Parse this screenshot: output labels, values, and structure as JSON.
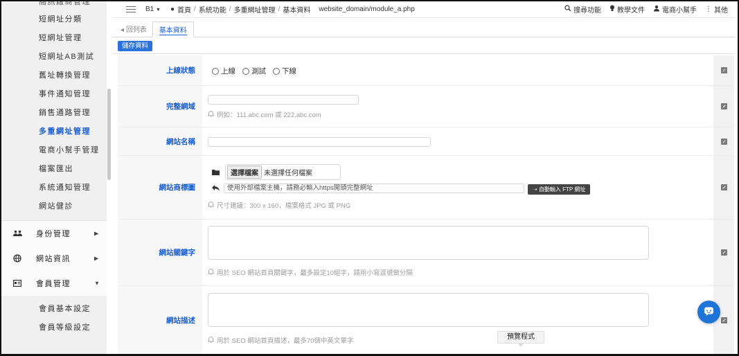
{
  "sidebar": {
    "top_sub_items": [
      {
        "label": "簡訊廠商管理"
      },
      {
        "label": "短網址分類"
      },
      {
        "label": "短網址管理"
      },
      {
        "label": "短網址AB測試"
      },
      {
        "label": "舊址轉換管理"
      },
      {
        "label": "事件通知管理"
      },
      {
        "label": "銷售通路管理"
      },
      {
        "label": "多重網址管理",
        "active": true
      },
      {
        "label": "電商小幫手管理"
      },
      {
        "label": "檔案匯出"
      },
      {
        "label": "系統通知管理"
      },
      {
        "label": "網站健診"
      }
    ],
    "main_items": [
      {
        "label": "身份管理",
        "icon": "users-icon"
      },
      {
        "label": "網站資訊",
        "icon": "globe-icon"
      },
      {
        "label": "會員管理",
        "icon": "id-card-icon"
      }
    ],
    "member_sub_items": [
      {
        "label": "會員基本設定"
      },
      {
        "label": "會員等級設定"
      }
    ]
  },
  "topbar": {
    "branch": "B1",
    "breadcrumbs": [
      "首頁",
      "系統功能",
      "多重網址管理",
      "基本資料"
    ],
    "path": "website_domain/module_a.php",
    "search": "搜尋功能",
    "docs": "教學文件",
    "helper": "電商小幫手",
    "more": "其他"
  },
  "tabs": {
    "back": "回列表",
    "basic": "基本資料"
  },
  "save_button": "儲存資料",
  "form": {
    "status": {
      "label": "上線狀態",
      "options": [
        "上線",
        "測試",
        "下線"
      ]
    },
    "domain": {
      "label": "完整網域",
      "value": "",
      "hint": "例如：111.abc.com 或 222.abc.com"
    },
    "site_name": {
      "label": "網站名稱",
      "value": ""
    },
    "logo": {
      "label": "網站商標圖",
      "file_button": "選擇檔案",
      "file_status": "未選擇任何檔案",
      "url_placeholder": "使用外部檔案主機，請務必輸入https開頭完整網址",
      "ftp_button": "自動輸入 FTP 網址",
      "hint": "尺寸建議：300 x 160，檔案格式 JPG 或 PNG"
    },
    "keywords": {
      "label": "網站關鍵字",
      "hint": "用於 SEO 網站首頁關鍵字，最多設定10組字，請用小寫逗號做分隔"
    },
    "description": {
      "label": "網站描述",
      "hint": "用於 SEO 網站首頁描述，最多70個中英文單字"
    }
  },
  "preview_tooltip": "預覽程式",
  "colors": {
    "accent": "#1a5fd0",
    "save_button": "#2b73db",
    "chat_bubble": "#1e74d8"
  }
}
